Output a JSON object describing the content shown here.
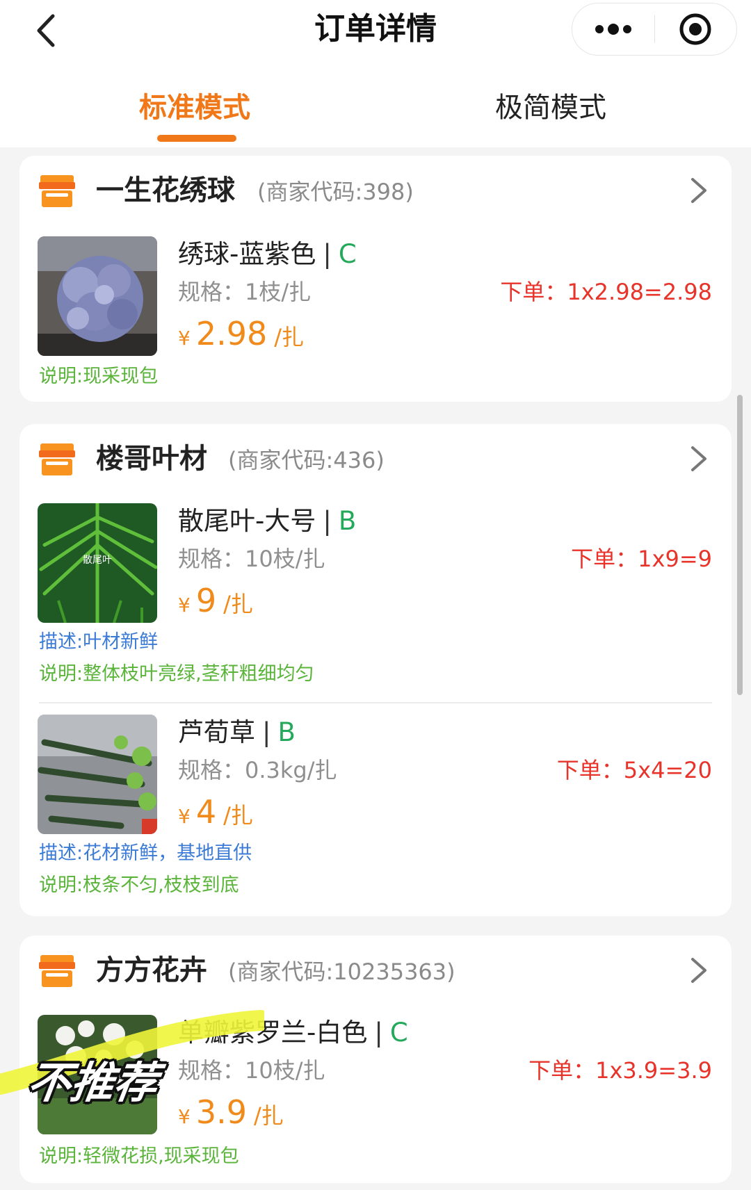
{
  "header": {
    "title": "订单详情",
    "back_icon": "chevron-left-icon",
    "more_icon": "more-dots-icon",
    "close_icon": "target-close-icon"
  },
  "tabs": [
    {
      "label": "标准模式",
      "active": true
    },
    {
      "label": "极简模式",
      "active": false
    }
  ],
  "colors": {
    "accent": "#f07818",
    "grade": "#23a95a",
    "order": "#e8332a",
    "price": "#f08a1a",
    "desc": "#3b7bd6",
    "note": "#5ab43a"
  },
  "shops": [
    {
      "name": "一生花绣球",
      "code": "(商家代码:398)",
      "items": [
        {
          "name": "绣球-蓝紫色",
          "sep": "|",
          "grade": "C",
          "spec": "规格：1枝/扎",
          "order": "下单：1x2.98=2.98",
          "yen": "¥",
          "price": "2.98",
          "unit": "/扎",
          "note": "说明:现采现包"
        }
      ]
    },
    {
      "name": "楼哥叶材",
      "code": "(商家代码:436)",
      "items": [
        {
          "name": "散尾叶-大号",
          "sep": "|",
          "grade": "B",
          "spec": "规格：10枝/扎",
          "order": "下单：1x9=9",
          "yen": "¥",
          "price": "9",
          "unit": "/扎",
          "thumb_label": "散尾叶",
          "desc": "描述:叶材新鲜",
          "note": "说明:整体枝叶亮绿,茎秆粗细均匀"
        },
        {
          "name": "芦荀草",
          "sep": "|",
          "grade": "B",
          "spec": "规格：0.3kg/扎",
          "order": "下单：5x4=20",
          "yen": "¥",
          "price": "4",
          "unit": "/扎",
          "desc": "描述:花材新鲜，基地直供",
          "note": "说明:枝条不匀,枝枝到底"
        }
      ]
    },
    {
      "name": "方方花卉",
      "code": "(商家代码:10235363)",
      "items": [
        {
          "name": "单瓣紫罗兰-白色",
          "sep": "|",
          "grade": "C",
          "spec": "规格：10枝/扎",
          "order": "下单：1x3.9=3.9",
          "yen": "¥",
          "price": "3.9",
          "unit": "/扎",
          "note": "说明:轻微花损,现采现包"
        }
      ]
    }
  ],
  "overlay": {
    "sticker_text": "不推荐"
  }
}
